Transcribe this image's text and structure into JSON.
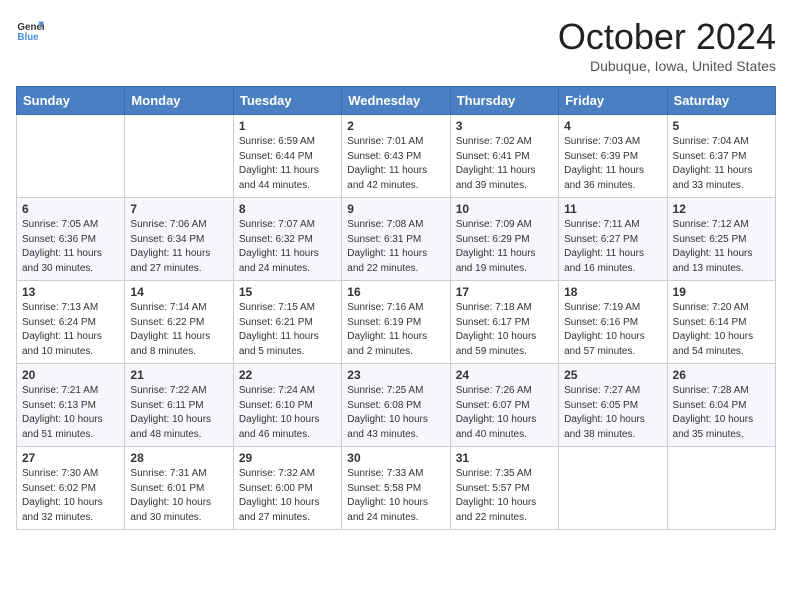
{
  "header": {
    "logo_line1": "General",
    "logo_line2": "Blue",
    "month_title": "October 2024",
    "location": "Dubuque, Iowa, United States"
  },
  "weekdays": [
    "Sunday",
    "Monday",
    "Tuesday",
    "Wednesday",
    "Thursday",
    "Friday",
    "Saturday"
  ],
  "weeks": [
    [
      {
        "day": "",
        "info": ""
      },
      {
        "day": "",
        "info": ""
      },
      {
        "day": "1",
        "info": "Sunrise: 6:59 AM\nSunset: 6:44 PM\nDaylight: 11 hours and 44 minutes."
      },
      {
        "day": "2",
        "info": "Sunrise: 7:01 AM\nSunset: 6:43 PM\nDaylight: 11 hours and 42 minutes."
      },
      {
        "day": "3",
        "info": "Sunrise: 7:02 AM\nSunset: 6:41 PM\nDaylight: 11 hours and 39 minutes."
      },
      {
        "day": "4",
        "info": "Sunrise: 7:03 AM\nSunset: 6:39 PM\nDaylight: 11 hours and 36 minutes."
      },
      {
        "day": "5",
        "info": "Sunrise: 7:04 AM\nSunset: 6:37 PM\nDaylight: 11 hours and 33 minutes."
      }
    ],
    [
      {
        "day": "6",
        "info": "Sunrise: 7:05 AM\nSunset: 6:36 PM\nDaylight: 11 hours and 30 minutes."
      },
      {
        "day": "7",
        "info": "Sunrise: 7:06 AM\nSunset: 6:34 PM\nDaylight: 11 hours and 27 minutes."
      },
      {
        "day": "8",
        "info": "Sunrise: 7:07 AM\nSunset: 6:32 PM\nDaylight: 11 hours and 24 minutes."
      },
      {
        "day": "9",
        "info": "Sunrise: 7:08 AM\nSunset: 6:31 PM\nDaylight: 11 hours and 22 minutes."
      },
      {
        "day": "10",
        "info": "Sunrise: 7:09 AM\nSunset: 6:29 PM\nDaylight: 11 hours and 19 minutes."
      },
      {
        "day": "11",
        "info": "Sunrise: 7:11 AM\nSunset: 6:27 PM\nDaylight: 11 hours and 16 minutes."
      },
      {
        "day": "12",
        "info": "Sunrise: 7:12 AM\nSunset: 6:25 PM\nDaylight: 11 hours and 13 minutes."
      }
    ],
    [
      {
        "day": "13",
        "info": "Sunrise: 7:13 AM\nSunset: 6:24 PM\nDaylight: 11 hours and 10 minutes."
      },
      {
        "day": "14",
        "info": "Sunrise: 7:14 AM\nSunset: 6:22 PM\nDaylight: 11 hours and 8 minutes."
      },
      {
        "day": "15",
        "info": "Sunrise: 7:15 AM\nSunset: 6:21 PM\nDaylight: 11 hours and 5 minutes."
      },
      {
        "day": "16",
        "info": "Sunrise: 7:16 AM\nSunset: 6:19 PM\nDaylight: 11 hours and 2 minutes."
      },
      {
        "day": "17",
        "info": "Sunrise: 7:18 AM\nSunset: 6:17 PM\nDaylight: 10 hours and 59 minutes."
      },
      {
        "day": "18",
        "info": "Sunrise: 7:19 AM\nSunset: 6:16 PM\nDaylight: 10 hours and 57 minutes."
      },
      {
        "day": "19",
        "info": "Sunrise: 7:20 AM\nSunset: 6:14 PM\nDaylight: 10 hours and 54 minutes."
      }
    ],
    [
      {
        "day": "20",
        "info": "Sunrise: 7:21 AM\nSunset: 6:13 PM\nDaylight: 10 hours and 51 minutes."
      },
      {
        "day": "21",
        "info": "Sunrise: 7:22 AM\nSunset: 6:11 PM\nDaylight: 10 hours and 48 minutes."
      },
      {
        "day": "22",
        "info": "Sunrise: 7:24 AM\nSunset: 6:10 PM\nDaylight: 10 hours and 46 minutes."
      },
      {
        "day": "23",
        "info": "Sunrise: 7:25 AM\nSunset: 6:08 PM\nDaylight: 10 hours and 43 minutes."
      },
      {
        "day": "24",
        "info": "Sunrise: 7:26 AM\nSunset: 6:07 PM\nDaylight: 10 hours and 40 minutes."
      },
      {
        "day": "25",
        "info": "Sunrise: 7:27 AM\nSunset: 6:05 PM\nDaylight: 10 hours and 38 minutes."
      },
      {
        "day": "26",
        "info": "Sunrise: 7:28 AM\nSunset: 6:04 PM\nDaylight: 10 hours and 35 minutes."
      }
    ],
    [
      {
        "day": "27",
        "info": "Sunrise: 7:30 AM\nSunset: 6:02 PM\nDaylight: 10 hours and 32 minutes."
      },
      {
        "day": "28",
        "info": "Sunrise: 7:31 AM\nSunset: 6:01 PM\nDaylight: 10 hours and 30 minutes."
      },
      {
        "day": "29",
        "info": "Sunrise: 7:32 AM\nSunset: 6:00 PM\nDaylight: 10 hours and 27 minutes."
      },
      {
        "day": "30",
        "info": "Sunrise: 7:33 AM\nSunset: 5:58 PM\nDaylight: 10 hours and 24 minutes."
      },
      {
        "day": "31",
        "info": "Sunrise: 7:35 AM\nSunset: 5:57 PM\nDaylight: 10 hours and 22 minutes."
      },
      {
        "day": "",
        "info": ""
      },
      {
        "day": "",
        "info": ""
      }
    ]
  ]
}
